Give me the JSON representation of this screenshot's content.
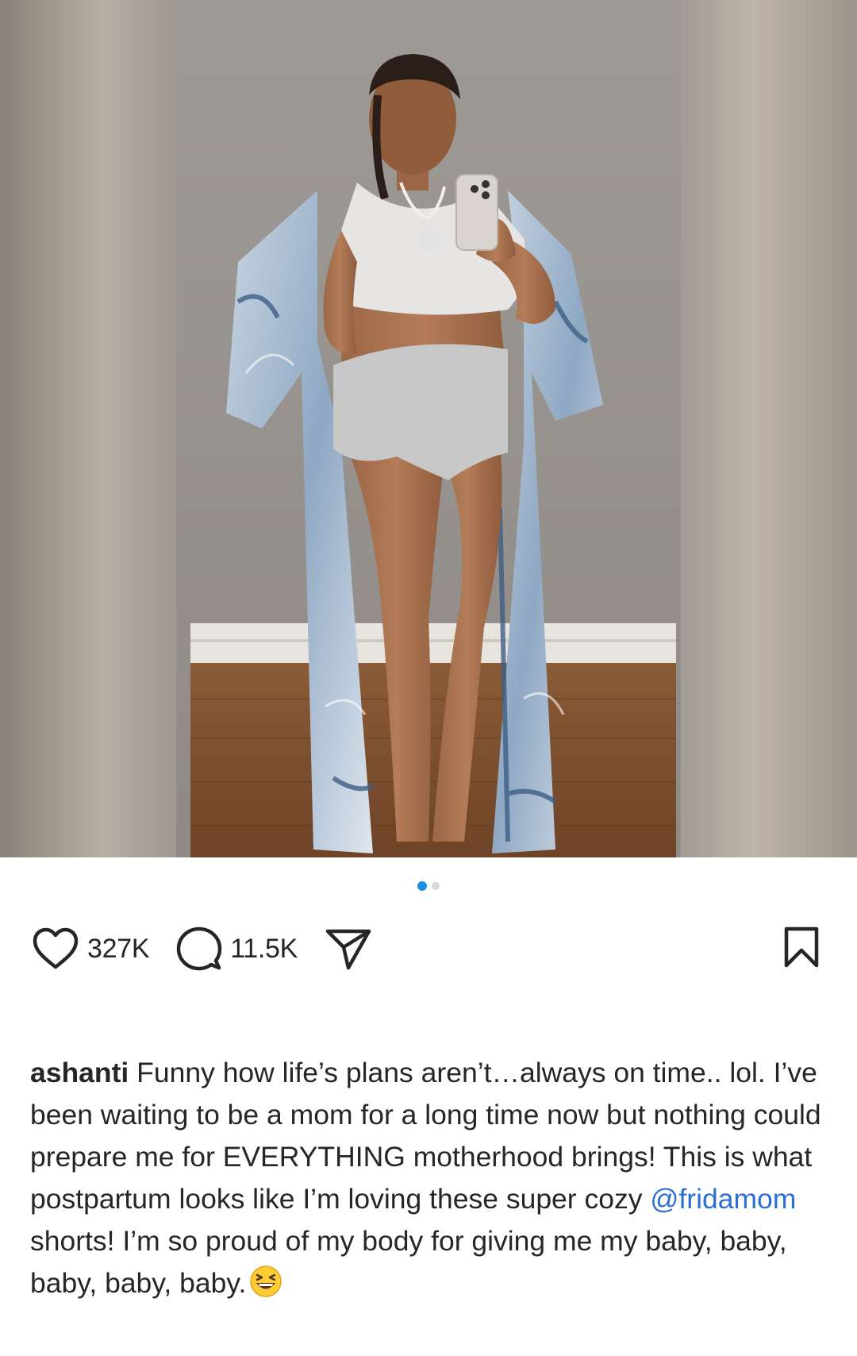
{
  "post": {
    "carousel": {
      "total": 2,
      "active_index": 0
    },
    "actions": {
      "likes": "327K",
      "comments": "11.5K"
    },
    "caption": {
      "username": "ashanti",
      "text_before_mention": " Funny how life’s plans aren’t…always on time.. lol. I’ve been waiting to be a mom for a long time now but nothing could prepare me for EVERYTHING motherhood brings! This is what postpartum looks like I’m loving these super cozy ",
      "mention": "@fridamom",
      "text_after_mention": " shorts! I’m so proud of my body for giving me my baby, baby, baby, baby, baby.",
      "emoji": "grinning-squinting-face"
    }
  }
}
